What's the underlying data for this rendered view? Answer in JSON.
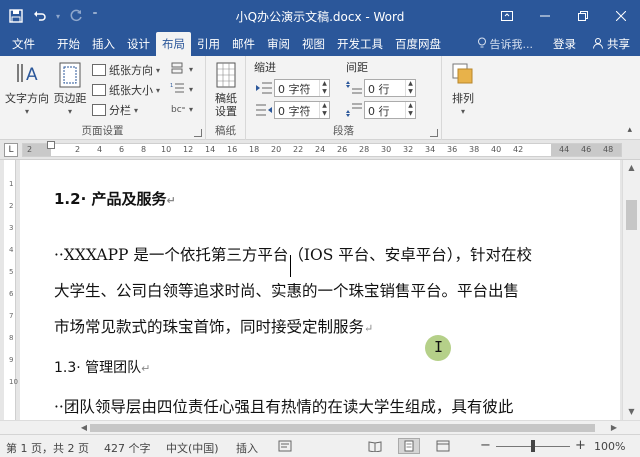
{
  "titlebar": {
    "title": "小Q办公演示文稿.docx - Word",
    "qat": {
      "save_icon": "save-icon",
      "undo_icon": "undo-icon",
      "redo_icon": "redo-icon"
    },
    "window_controls": [
      "ribbon-display-icon",
      "minimize-icon",
      "restore-icon",
      "close-icon"
    ]
  },
  "tabs": [
    {
      "label": "文件",
      "active": false
    },
    {
      "label": "开始",
      "active": false
    },
    {
      "label": "插入",
      "active": false
    },
    {
      "label": "设计",
      "active": false
    },
    {
      "label": "布局",
      "active": true
    },
    {
      "label": "引用",
      "active": false
    },
    {
      "label": "邮件",
      "active": false
    },
    {
      "label": "审阅",
      "active": false
    },
    {
      "label": "视图",
      "active": false
    },
    {
      "label": "开发工具",
      "active": false
    },
    {
      "label": "百度网盘",
      "active": false
    }
  ],
  "tell_me": "告诉我...",
  "login": "登录",
  "share": "共享",
  "ribbon": {
    "page_setup": {
      "label": "页面设置",
      "text_direction": "文字方向",
      "margins": "页边距",
      "orientation": "纸张方向",
      "size": "纸张大小",
      "columns": "分栏"
    },
    "draft": {
      "label": "稿纸",
      "button": "稿纸\n设置"
    },
    "paragraph": {
      "label": "段落",
      "indent_title": "缩进",
      "spacing_title": "间距",
      "indent_left": "0 字符",
      "indent_right": "0 字符",
      "spacing_before": "0 行",
      "spacing_after": "0 行"
    },
    "arrange": {
      "label": "排列"
    }
  },
  "ruler": {
    "numbers": [
      "2",
      "2",
      "4",
      "6",
      "8",
      "10",
      "12",
      "14",
      "16",
      "18",
      "20",
      "22",
      "24",
      "26",
      "28",
      "30",
      "32",
      "34",
      "36",
      "38",
      "40",
      "42",
      "44",
      "46",
      "48"
    ],
    "vertical_numbers": [
      "1",
      "2",
      "3",
      "4",
      "5",
      "6",
      "7",
      "8",
      "9",
      "10"
    ]
  },
  "document": {
    "heading": "1.2· 产品及服务",
    "para1_line1": "··XXXAPP 是一个依托第三方平台（IOS 平台、安卓平台），针对在校",
    "para1_line2": "大学生、公司白领等追求时尚、实惠的一个珠宝销售平台。平台出售",
    "para1_line3": "市场常见款式的珠宝首饰，同时接受定制服务",
    "subheading": "1.3· 管理团队",
    "para2_line1": "··团队领导层由四位责任心强且有热情的在读大学生组成，具有彼此",
    "return_mark": "↵"
  },
  "statusbar": {
    "page": "第 1 页，共 2 页",
    "words": "427 个字",
    "language": "中文(中国)",
    "mode": "插入",
    "zoom": "100%",
    "zoom_minus": "−",
    "zoom_plus": "+"
  },
  "colors": {
    "accent": "#2b579a",
    "ribbon_bg": "#f3f3f3",
    "cursor_highlight": "#8fbf3a"
  }
}
